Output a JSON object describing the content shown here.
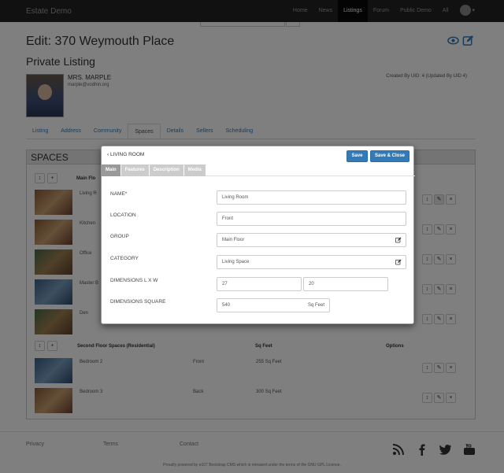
{
  "navbar": {
    "brand": "Estate Demo",
    "items": [
      "Home",
      "News",
      "Listings",
      "Forum",
      "Public Demo",
      "All"
    ],
    "active_index": 2
  },
  "page": {
    "title": "Edit: 370 Weymouth Place",
    "subtitle": "Private Listing",
    "owner_name": "MRS. MARPLE",
    "owner_email": "marple@vodhin.org",
    "created_by": "Created By UID: 4 (Updated By UID 4)"
  },
  "tabs": [
    "Listing",
    "Address",
    "Community",
    "Spaces",
    "Details",
    "Sellers",
    "Scheduling"
  ],
  "active_tab_index": 3,
  "spaces": {
    "heading": "SPACES",
    "groups": [
      {
        "title": "Main Flo",
        "rows": [
          {
            "name": "Living R",
            "location": "",
            "sq": ""
          },
          {
            "name": "Kitchen",
            "location": "",
            "sq": ""
          },
          {
            "name": "Office",
            "location": "",
            "sq": ""
          },
          {
            "name": "Master B",
            "location": "",
            "sq": ""
          },
          {
            "name": "Den",
            "location": "",
            "sq": ""
          }
        ]
      },
      {
        "title": "Second Floor Spaces (Residential)",
        "sq_header": "Sq Feet",
        "options_header": "Options",
        "rows": [
          {
            "name": "Bedroom 2",
            "location": "Front",
            "sq": "255 Sq Feet"
          },
          {
            "name": "Bedroom 3",
            "location": "Back",
            "sq": "300 Sq Feet"
          }
        ]
      }
    ]
  },
  "modal": {
    "back_label": "LIVING ROOM",
    "save_label": "Save",
    "save_close_label": "Save & Close",
    "tabs": [
      "Main",
      "Features",
      "Description",
      "Media"
    ],
    "active_tab_index": 0,
    "fields": {
      "name_label": "NAME*",
      "name_value": "Living Room",
      "location_label": "LOCATION",
      "location_value": "Front",
      "group_label": "GROUP",
      "group_value": "Main Floor",
      "category_label": "CATEGORY",
      "category_value": "Living Space",
      "dimensions_label": "DIMENSIONS L X W",
      "dim_length": "27",
      "dim_width": "20",
      "square_label": "DIMENSIONS SQUARE",
      "square_value": "540",
      "square_unit": "Sq Feet"
    }
  },
  "footer": {
    "links": [
      "Privacy",
      "Terms",
      "Contact"
    ],
    "note": "Proudly powered by e107 Bootstrap CMS which is released under the terms of the GNU GPL License."
  },
  "colors": {
    "primary": "#337ab7",
    "navbar": "#222222"
  }
}
